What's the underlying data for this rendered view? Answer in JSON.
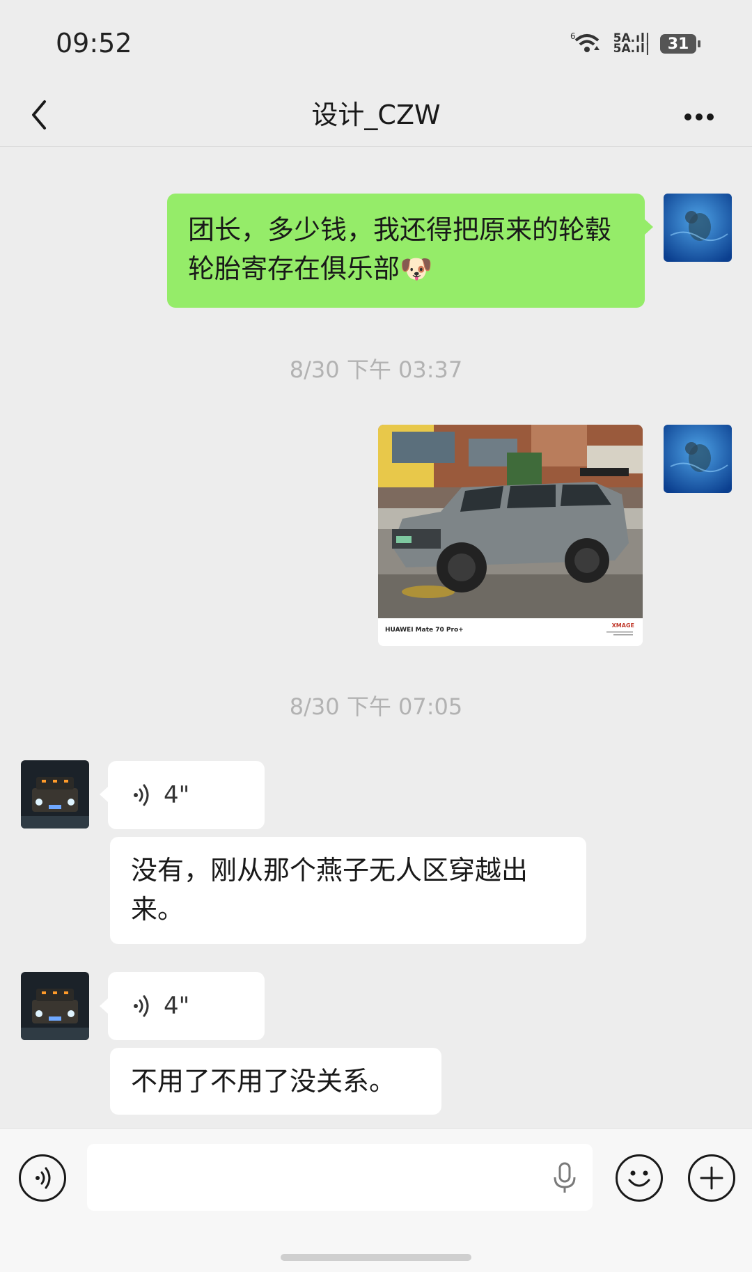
{
  "status_bar": {
    "time": "09:52",
    "network_top": "5A",
    "network_bottom": "5A",
    "wifi_gen": "6",
    "battery": "31"
  },
  "header": {
    "title": "设计_CZW"
  },
  "messages": {
    "m1": {
      "sender": "me",
      "type": "text",
      "text": "团长，多少钱，我还得把原来的轮毂轮胎寄存在俱乐部",
      "emoji": "🐶"
    },
    "t1": {
      "type": "timestamp",
      "text": "8/30 下午 03:37"
    },
    "m2": {
      "sender": "me",
      "type": "image",
      "footer_brand": "HUAWEI Mate 70 Pro+",
      "footer_mark": "XMAGE"
    },
    "t2": {
      "type": "timestamp",
      "text": "8/30 下午 07:05"
    },
    "m3": {
      "sender": "other",
      "type": "voice",
      "duration": "4\"",
      "transcript": "没有，刚从那个燕子无人区穿越出来。"
    },
    "m4": {
      "sender": "other",
      "type": "voice",
      "duration": "4\"",
      "transcript": "不用了不用了没关系。"
    }
  },
  "input_bar": {
    "voice_icon": "voice-mode-icon",
    "mic_icon": "microphone-icon",
    "emoji_icon": "emoji-icon",
    "plus_icon": "plus-icon",
    "placeholder": ""
  },
  "colors": {
    "background": "#ededed",
    "my_bubble": "#95ec69",
    "other_bubble": "#ffffff",
    "timestamp": "#b2b2b2"
  }
}
